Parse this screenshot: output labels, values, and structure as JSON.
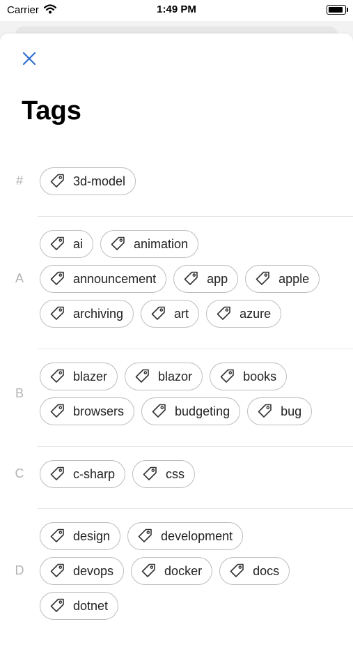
{
  "status": {
    "carrier": "Carrier",
    "time": "1:49 PM"
  },
  "title": "Tags",
  "sections": [
    {
      "letter": "#",
      "rows": [
        [
          "3d-model"
        ]
      ]
    },
    {
      "letter": "A",
      "rows": [
        [
          "ai",
          "animation"
        ],
        [
          "announcement",
          "app",
          "apple"
        ],
        [
          "archiving",
          "art",
          "azure"
        ]
      ]
    },
    {
      "letter": "B",
      "rows": [
        [
          "blazer",
          "blazor",
          "books"
        ],
        [
          "browsers",
          "budgeting",
          "bug"
        ]
      ]
    },
    {
      "letter": "C",
      "rows": [
        [
          "c-sharp",
          "css"
        ]
      ]
    },
    {
      "letter": "D",
      "rows": [
        [
          "design",
          "development"
        ],
        [
          "devops",
          "docker",
          "docs"
        ],
        [
          "dotnet"
        ]
      ]
    }
  ],
  "colors": {
    "accent": "#2f6fd0",
    "chip_border": "#bdbdbd",
    "index_letter": "#b3b3b3"
  },
  "icons": {
    "close": "close-icon",
    "tag": "tag-icon",
    "wifi": "wifi-icon",
    "battery": "battery-icon"
  }
}
